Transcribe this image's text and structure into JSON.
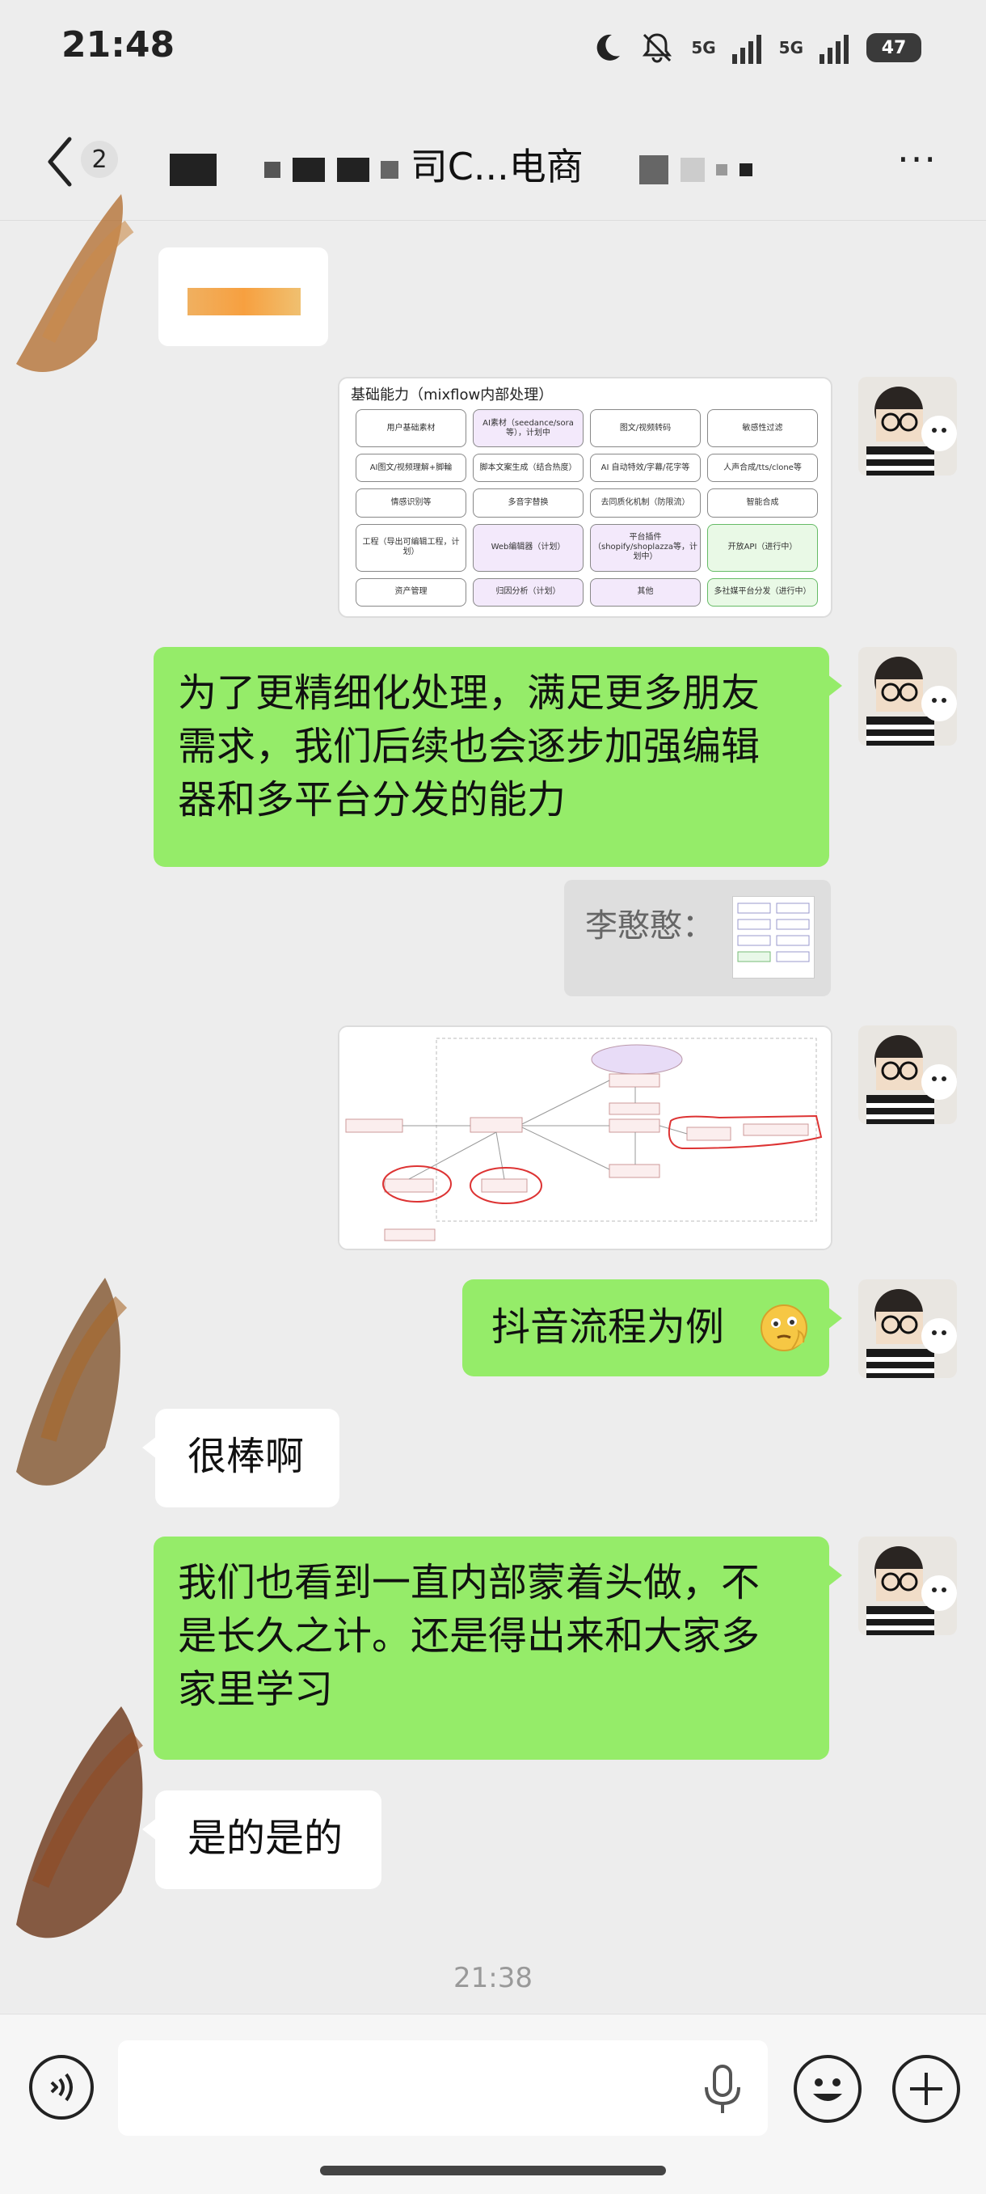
{
  "status_bar": {
    "time": "21:48",
    "signal_1": "5G",
    "signal_2": "5G",
    "battery": "47"
  },
  "nav": {
    "unread_count": "2",
    "title_visible_1": "司C...电商",
    "more_label": "···"
  },
  "messages": [
    {
      "id": "m1",
      "sender": "other",
      "type": "image-obscured"
    },
    {
      "id": "m2",
      "sender": "me",
      "type": "image",
      "caption": "基础能力（mixflow内部处理）",
      "grid": [
        [
          "用户基础素材",
          "AI素材（seedance/sora等），计划中",
          "图文/视频转码",
          "敏感性过滤"
        ],
        [
          "AI图文/视频理解+脚輪",
          "脚本文案生成（结合热度）",
          "AI 自动特效/字幕/花字等",
          "人声合成/tts/clone等"
        ],
        [
          "情感识别等",
          "多音字替换",
          "去同质化机制（防限流）",
          "智能合成"
        ],
        [
          "工程（导出可编辑工程，计划）",
          "Web编辑器（计划）",
          "平台插件（shopify/shoplazza等，计划中）",
          "开放API（进行中）"
        ],
        [
          "资产管理",
          "归因分析（计划）",
          "其他",
          "多社媒平台分发（进行中）"
        ]
      ]
    },
    {
      "id": "m3",
      "sender": "me",
      "type": "text",
      "lines": [
        "为了更精细化处理，满足更多朋友",
        "需求，我们后续也会逐步加强编辑",
        "器和多平台分发的能力"
      ]
    },
    {
      "id": "m3q",
      "type": "quote",
      "label": "李憨憨："
    },
    {
      "id": "m4",
      "sender": "me",
      "type": "image-flowchart"
    },
    {
      "id": "m5",
      "sender": "me",
      "type": "text",
      "text": "抖音流程为例"
    },
    {
      "id": "m6",
      "sender": "other",
      "type": "text",
      "text": "很棒啊"
    },
    {
      "id": "m7",
      "sender": "me",
      "type": "text",
      "lines": [
        "我们也看到一直内部蒙着头做，不",
        "是长久之计。还是得出来和大家多",
        "家里学习"
      ]
    },
    {
      "id": "m8",
      "sender": "other",
      "type": "text",
      "text": "是的是的"
    }
  ],
  "timestamp": "21:38",
  "input": {
    "placeholder": ""
  },
  "colors": {
    "me_bubble": "#95ec69",
    "other_bubble": "#ffffff",
    "background": "#ededed"
  }
}
